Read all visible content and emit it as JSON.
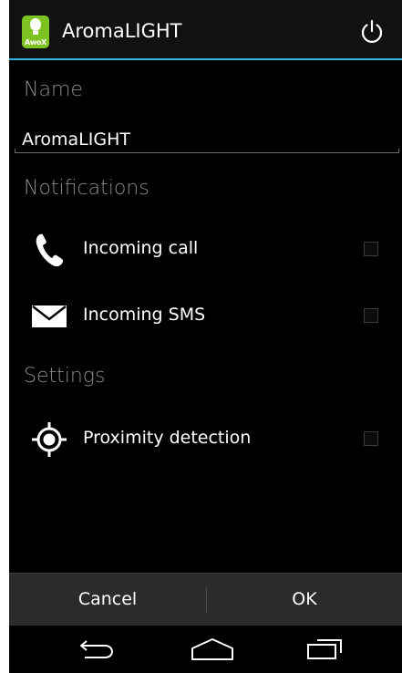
{
  "app": {
    "title": "AromaLIGHT",
    "brand_mark": "AwoX",
    "accent_color": "#33b5e5",
    "icon_color": "#7dc322"
  },
  "actionbar": {
    "power_icon": "power-icon"
  },
  "name_section": {
    "header": "Name",
    "value": "AromaLIGHT"
  },
  "notifications": {
    "header": "Notifications",
    "items": [
      {
        "label": "Incoming call",
        "icon": "phone-icon",
        "checked": false
      },
      {
        "label": "Incoming SMS",
        "icon": "envelope-icon",
        "checked": false
      }
    ]
  },
  "settings": {
    "header": "Settings",
    "items": [
      {
        "label": "Proximity detection",
        "icon": "crosshair-icon",
        "checked": false
      }
    ]
  },
  "dialog_buttons": {
    "cancel": "Cancel",
    "ok": "OK"
  },
  "navbar": {
    "icons": [
      "back-icon",
      "home-icon",
      "recents-icon"
    ]
  }
}
